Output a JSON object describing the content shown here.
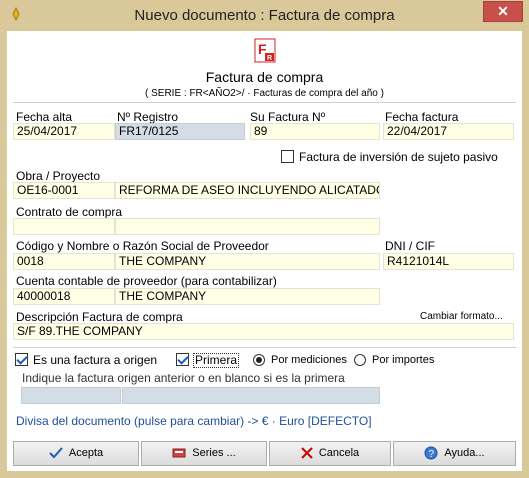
{
  "window": {
    "title": "Nuevo documento : Factura de compra",
    "close_glyph": "✕"
  },
  "header": {
    "logo_letter": "F",
    "logo_sub": "R",
    "doc_title": "Factura de compra",
    "serie_text": "( SERIE : FR<AÑO2>/ · Facturas de compra del año )"
  },
  "row1": {
    "fecha_alta_label": "Fecha alta",
    "fecha_alta_value": "25/04/2017",
    "registro_label": "Nº Registro",
    "registro_value": "FR17/0125",
    "su_factura_label": "Su Factura Nº",
    "su_factura_value": "89",
    "fecha_factura_label": "Fecha factura",
    "fecha_factura_value": "22/04/2017"
  },
  "inversion": {
    "label": "Factura de inversión de sujeto pasivo",
    "checked": false
  },
  "obra": {
    "label": "Obra / Proyecto",
    "code": "OE16-0001",
    "name": "REFORMA DE ASEO INCLUYENDO ALICATADO"
  },
  "contrato": {
    "label": "Contrato de compra",
    "code": "",
    "name": ""
  },
  "proveedor": {
    "label": "Código y Nombre o Razón Social de Proveedor",
    "code": "0018",
    "name": "THE COMPANY",
    "dni_label": "DNI / CIF",
    "dni_value": "R4121014L"
  },
  "cuenta": {
    "label": "Cuenta contable de proveedor (para contabilizar)",
    "code": "40000018",
    "name": "THE COMPANY"
  },
  "descripcion": {
    "label": "Descripción Factura de compra",
    "change_link": "Cambiar formato...",
    "value": "S/F 89.THE COMPANY"
  },
  "origen": {
    "es_origen_label": "Es una factura a origen",
    "es_origen_checked": true,
    "primera_label": "Primera",
    "primera_checked": true,
    "radio_mediciones": "Por mediciones",
    "radio_importes": "Por importes",
    "selected": "Por mediciones",
    "hint": "Indique la factura origen anterior o en blanco si es la primera"
  },
  "divisa": {
    "text": "Divisa del documento (pulse para cambiar) -> € · Euro [DEFECTO]"
  },
  "buttons": {
    "acepta": "Acepta",
    "series": "Series ...",
    "cancela": "Cancela",
    "ayuda": "Ayuda..."
  },
  "colors": {
    "frame": "#d9c899",
    "field_bg": "#ffffe6",
    "readonly_bg": "#d4dce6",
    "link_blue": "#1f4e99",
    "logo_red": "#d62020"
  }
}
